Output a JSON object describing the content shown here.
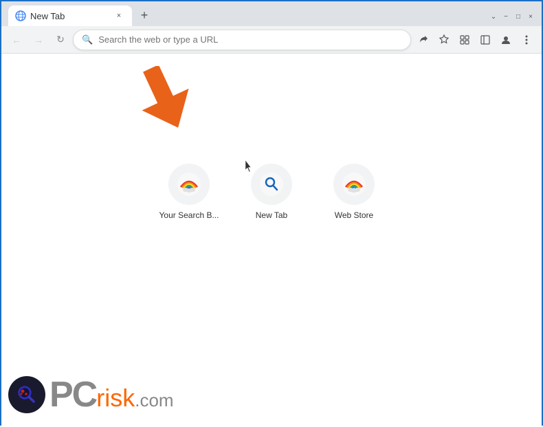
{
  "window": {
    "title": "New Tab",
    "controls": {
      "minimize": "−",
      "maximize": "□",
      "close": "×",
      "chevron_down": "⌄"
    }
  },
  "tab": {
    "label": "New Tab",
    "close_label": "×"
  },
  "toolbar": {
    "back_label": "←",
    "forward_label": "→",
    "reload_label": "↻",
    "new_tab_label": "+",
    "search_placeholder": "Search the web or type a URL",
    "share_label": "↗",
    "bookmark_label": "☆",
    "extensions_label": "⊞",
    "sidebar_label": "▯",
    "profile_label": "👤",
    "menu_label": "⋮"
  },
  "shortcuts": [
    {
      "label": "Your Search B...",
      "type": "rainbow"
    },
    {
      "label": "New Tab",
      "type": "search"
    },
    {
      "label": "Web Store",
      "type": "rainbow2"
    }
  ],
  "watermark": {
    "pc_text": "PC",
    "risk_text": "risk",
    "com_text": ".com"
  },
  "colors": {
    "accent_blue": "#1a6fc4",
    "arrow_orange": "#e8621a",
    "toolbar_bg": "#f1f3f4",
    "tab_active_bg": "#ffffff",
    "titlebar_bg": "#dee1e6"
  }
}
